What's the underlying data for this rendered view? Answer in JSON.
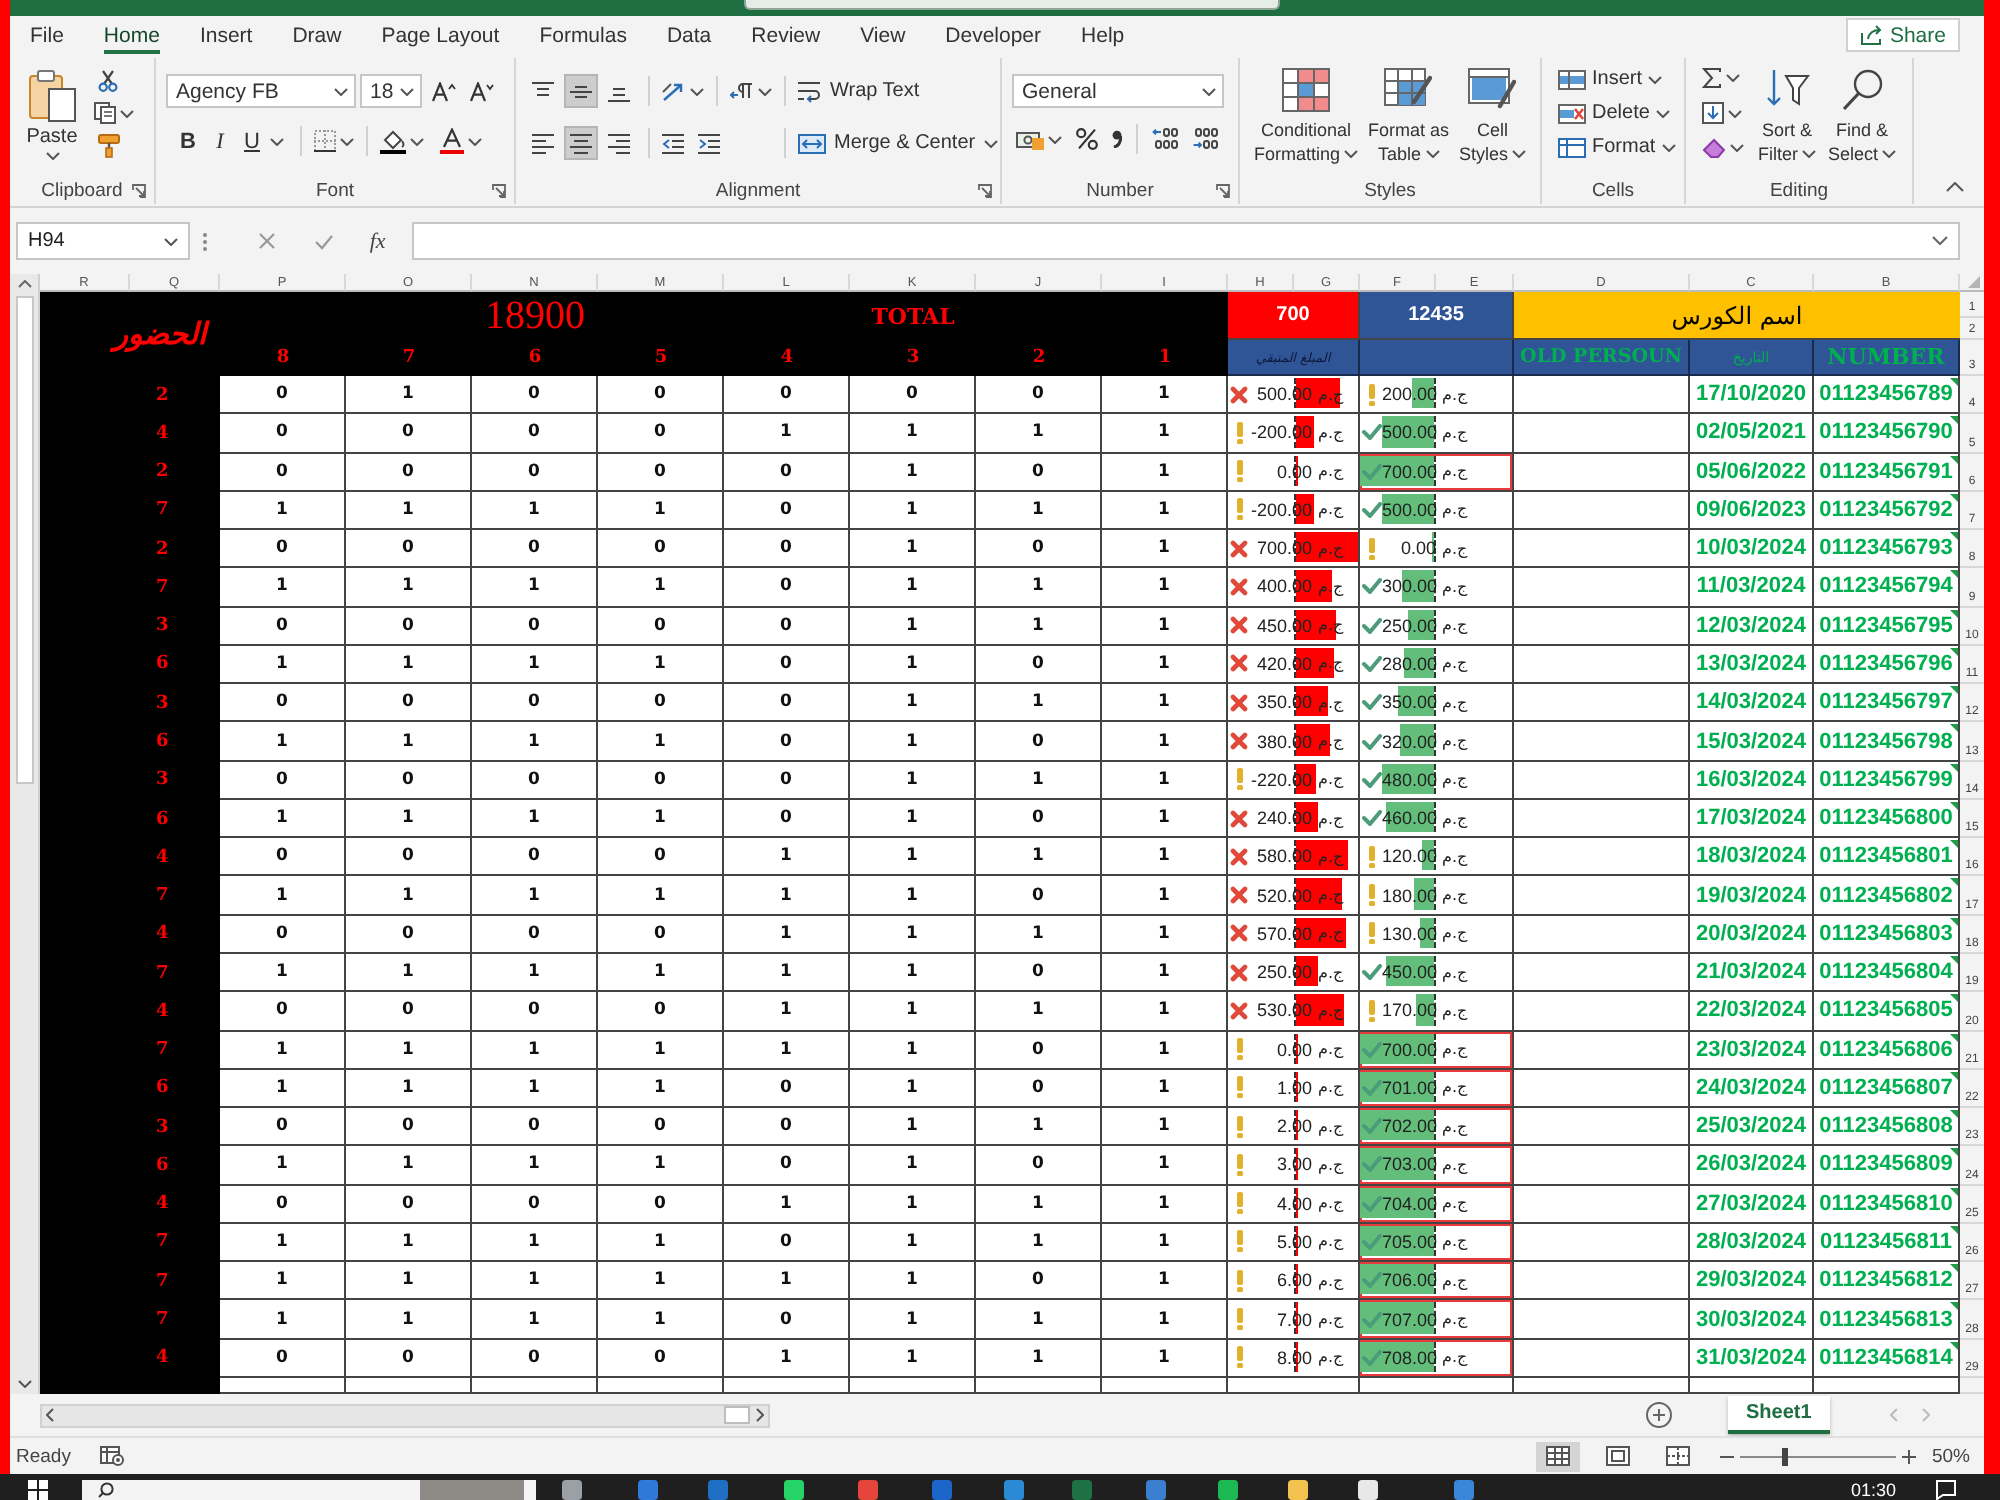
{
  "menu_tabs": [
    {
      "label": "File",
      "selected": false
    },
    {
      "label": "Home",
      "selected": true
    },
    {
      "label": "Insert",
      "selected": false
    },
    {
      "label": "Draw",
      "selected": false
    },
    {
      "label": "Page Layout",
      "selected": false
    },
    {
      "label": "Formulas",
      "selected": false
    },
    {
      "label": "Data",
      "selected": false
    },
    {
      "label": "Review",
      "selected": false
    },
    {
      "label": "View",
      "selected": false
    },
    {
      "label": "Developer",
      "selected": false
    },
    {
      "label": "Help",
      "selected": false
    }
  ],
  "share_button": "Share",
  "ribbon": {
    "clipboard": {
      "paste": "Paste",
      "label": "Clipboard"
    },
    "font": {
      "font_name": "Agency FB",
      "font_size": "18",
      "style_buttons": [
        "B",
        "I",
        "U"
      ],
      "label": "Font"
    },
    "alignment": {
      "vertical": [
        {
          "kind": "top",
          "selected": false
        },
        {
          "kind": "middle",
          "selected": true
        },
        {
          "kind": "bottom",
          "selected": false
        }
      ],
      "horizontal": [
        {
          "kind": "left",
          "selected": false
        },
        {
          "kind": "center",
          "selected": true
        },
        {
          "kind": "right",
          "selected": false
        }
      ],
      "wrap_text": "Wrap Text",
      "merge_center": "Merge & Center",
      "label": "Alignment"
    },
    "number": {
      "format": "General",
      "label": "Number"
    },
    "styles": {
      "buttons": [
        [
          "Conditional",
          "Formatting"
        ],
        [
          "Format as",
          "Table"
        ],
        [
          "Cell",
          "Styles"
        ]
      ],
      "label": "Styles"
    },
    "cells": {
      "buttons": [
        "Insert",
        "Delete",
        "Format"
      ],
      "label": "Cells"
    },
    "editing": {
      "buttons": [
        [
          "Sort &",
          "Filter"
        ],
        [
          "Find &",
          "Select"
        ]
      ],
      "label": "Editing"
    }
  },
  "formula_bar": {
    "name_box": "H94",
    "function_button": "fx"
  },
  "sheet": {
    "column_headers": [
      "R",
      "Q",
      "P",
      "O",
      "N",
      "M",
      "L",
      "K",
      "J",
      "I",
      "H",
      "G",
      "F",
      "E",
      "D",
      "C",
      "B"
    ],
    "row_headers": [
      "1",
      "2",
      "3",
      "4",
      "5",
      "6",
      "7",
      "8",
      "9",
      "10",
      "11",
      "12",
      "13",
      "14",
      "15",
      "16",
      "17",
      "18",
      "19",
      "20",
      "21",
      "22",
      "23",
      "24",
      "25",
      "26",
      "27",
      "28",
      "29"
    ],
    "attendance_title": "الحضور",
    "grand_total": "18900",
    "total_label": "TOTAL",
    "session_numbers": [
      "8",
      "7",
      "6",
      "5",
      "4",
      "3",
      "2",
      "1"
    ],
    "remaining_total": "700",
    "paid_total": "12435",
    "course_name": "اسم الكورس",
    "remaining_header": "المبلغ المتبقي",
    "old_person_header": "OLD PERSOUN",
    "date_header": "التاريخ",
    "number_header": "NUMBER",
    "rows": [
      {
        "attendance": "2",
        "sessions": [
          "0",
          "1",
          "0",
          "0",
          "0",
          "0",
          "0",
          "1"
        ],
        "remaining": {
          "kind": "cross",
          "amount": "500.00",
          "currency": "ج.م",
          "level": 0.71
        },
        "paid": {
          "kind": "warning",
          "amount": "200.00",
          "currency": "ج.م",
          "level": 0.29,
          "flagged": false
        },
        "date": "17/10/2020",
        "number": "01123456789"
      },
      {
        "attendance": "4",
        "sessions": [
          "0",
          "0",
          "0",
          "0",
          "1",
          "1",
          "1",
          "1"
        ],
        "remaining": {
          "kind": "warning",
          "amount": "-200.00",
          "currency": "ج.م",
          "level": 0.29
        },
        "paid": {
          "kind": "check",
          "amount": "500.00",
          "currency": "ج.م",
          "level": 0.71,
          "flagged": false
        },
        "date": "02/05/2021",
        "number": "01123456790"
      },
      {
        "attendance": "2",
        "sessions": [
          "0",
          "0",
          "0",
          "0",
          "0",
          "1",
          "0",
          "1"
        ],
        "remaining": {
          "kind": "warning",
          "amount": "0.00",
          "currency": "ج.م",
          "level": 0
        },
        "paid": {
          "kind": "check",
          "amount": "700.00",
          "currency": "ج.م",
          "level": 1,
          "flagged": true
        },
        "date": "05/06/2022",
        "number": "01123456791"
      },
      {
        "attendance": "7",
        "sessions": [
          "1",
          "1",
          "1",
          "1",
          "0",
          "1",
          "1",
          "1"
        ],
        "remaining": {
          "kind": "warning",
          "amount": "-200.00",
          "currency": "ج.م",
          "level": 0.29
        },
        "paid": {
          "kind": "check",
          "amount": "500.00",
          "currency": "ج.م",
          "level": 0.71,
          "flagged": false
        },
        "date": "09/06/2023",
        "number": "01123456792"
      },
      {
        "attendance": "2",
        "sessions": [
          "0",
          "0",
          "0",
          "0",
          "0",
          "1",
          "0",
          "1"
        ],
        "remaining": {
          "kind": "cross",
          "amount": "700.00",
          "currency": "ج.م",
          "level": 1
        },
        "paid": {
          "kind": "warning",
          "amount": "0.00",
          "currency": "ج.م",
          "level": 0,
          "flagged": false
        },
        "date": "10/03/2024",
        "number": "01123456793"
      },
      {
        "attendance": "7",
        "sessions": [
          "1",
          "1",
          "1",
          "1",
          "0",
          "1",
          "1",
          "1"
        ],
        "remaining": {
          "kind": "cross",
          "amount": "400.00",
          "currency": "ج.م",
          "level": 0.57
        },
        "paid": {
          "kind": "check",
          "amount": "300.00",
          "currency": "ج.م",
          "level": 0.43,
          "flagged": false
        },
        "date": "11/03/2024",
        "number": "01123456794"
      },
      {
        "attendance": "3",
        "sessions": [
          "0",
          "0",
          "0",
          "0",
          "0",
          "1",
          "1",
          "1"
        ],
        "remaining": {
          "kind": "cross",
          "amount": "450.00",
          "currency": "ج.م",
          "level": 0.64
        },
        "paid": {
          "kind": "check",
          "amount": "250.00",
          "currency": "ج.م",
          "level": 0.36,
          "flagged": false
        },
        "date": "12/03/2024",
        "number": "01123456795"
      },
      {
        "attendance": "6",
        "sessions": [
          "1",
          "1",
          "1",
          "1",
          "0",
          "1",
          "0",
          "1"
        ],
        "remaining": {
          "kind": "cross",
          "amount": "420.00",
          "currency": "ج.م",
          "level": 0.6
        },
        "paid": {
          "kind": "check",
          "amount": "280.00",
          "currency": "ج.م",
          "level": 0.4,
          "flagged": false
        },
        "date": "13/03/2024",
        "number": "01123456796"
      },
      {
        "attendance": "3",
        "sessions": [
          "0",
          "0",
          "0",
          "0",
          "0",
          "1",
          "1",
          "1"
        ],
        "remaining": {
          "kind": "cross",
          "amount": "350.00",
          "currency": "ج.م",
          "level": 0.5
        },
        "paid": {
          "kind": "check",
          "amount": "350.00",
          "currency": "ج.م",
          "level": 0.5,
          "flagged": false
        },
        "date": "14/03/2024",
        "number": "01123456797"
      },
      {
        "attendance": "6",
        "sessions": [
          "1",
          "1",
          "1",
          "1",
          "0",
          "1",
          "0",
          "1"
        ],
        "remaining": {
          "kind": "cross",
          "amount": "380.00",
          "currency": "ج.م",
          "level": 0.54
        },
        "paid": {
          "kind": "check",
          "amount": "320.00",
          "currency": "ج.م",
          "level": 0.46,
          "flagged": false
        },
        "date": "15/03/2024",
        "number": "01123456798"
      },
      {
        "attendance": "3",
        "sessions": [
          "0",
          "0",
          "0",
          "0",
          "0",
          "1",
          "1",
          "1"
        ],
        "remaining": {
          "kind": "warning",
          "amount": "-220.00",
          "currency": "ج.م",
          "level": 0.31
        },
        "paid": {
          "kind": "check",
          "amount": "480.00",
          "currency": "ج.م",
          "level": 0.69,
          "flagged": false
        },
        "date": "16/03/2024",
        "number": "01123456799"
      },
      {
        "attendance": "6",
        "sessions": [
          "1",
          "1",
          "1",
          "1",
          "0",
          "1",
          "0",
          "1"
        ],
        "remaining": {
          "kind": "cross",
          "amount": "240.00",
          "currency": "ج.م",
          "level": 0.34
        },
        "paid": {
          "kind": "check",
          "amount": "460.00",
          "currency": "ج.م",
          "level": 0.66,
          "flagged": false
        },
        "date": "17/03/2024",
        "number": "01123456800"
      },
      {
        "attendance": "4",
        "sessions": [
          "0",
          "0",
          "0",
          "0",
          "1",
          "1",
          "1",
          "1"
        ],
        "remaining": {
          "kind": "cross",
          "amount": "580.00",
          "currency": "ج.م",
          "level": 0.83
        },
        "paid": {
          "kind": "warning",
          "amount": "120.00",
          "currency": "ج.م",
          "level": 0.17,
          "flagged": false
        },
        "date": "18/03/2024",
        "number": "01123456801"
      },
      {
        "attendance": "7",
        "sessions": [
          "1",
          "1",
          "1",
          "1",
          "1",
          "1",
          "0",
          "1"
        ],
        "remaining": {
          "kind": "cross",
          "amount": "520.00",
          "currency": "ج.م",
          "level": 0.74
        },
        "paid": {
          "kind": "warning",
          "amount": "180.00",
          "currency": "ج.م",
          "level": 0.26,
          "flagged": false
        },
        "date": "19/03/2024",
        "number": "01123456802"
      },
      {
        "attendance": "4",
        "sessions": [
          "0",
          "0",
          "0",
          "0",
          "1",
          "1",
          "1",
          "1"
        ],
        "remaining": {
          "kind": "cross",
          "amount": "570.00",
          "currency": "ج.م",
          "level": 0.81
        },
        "paid": {
          "kind": "warning",
          "amount": "130.00",
          "currency": "ج.م",
          "level": 0.19,
          "flagged": false
        },
        "date": "20/03/2024",
        "number": "01123456803"
      },
      {
        "attendance": "7",
        "sessions": [
          "1",
          "1",
          "1",
          "1",
          "1",
          "1",
          "0",
          "1"
        ],
        "remaining": {
          "kind": "cross",
          "amount": "250.00",
          "currency": "ج.م",
          "level": 0.36
        },
        "paid": {
          "kind": "check",
          "amount": "450.00",
          "currency": "ج.م",
          "level": 0.64,
          "flagged": false
        },
        "date": "21/03/2024",
        "number": "01123456804"
      },
      {
        "attendance": "4",
        "sessions": [
          "0",
          "0",
          "0",
          "0",
          "1",
          "1",
          "1",
          "1"
        ],
        "remaining": {
          "kind": "cross",
          "amount": "530.00",
          "currency": "ج.م",
          "level": 0.76
        },
        "paid": {
          "kind": "warning",
          "amount": "170.00",
          "currency": "ج.م",
          "level": 0.24,
          "flagged": false
        },
        "date": "22/03/2024",
        "number": "01123456805"
      },
      {
        "attendance": "7",
        "sessions": [
          "1",
          "1",
          "1",
          "1",
          "1",
          "1",
          "0",
          "1"
        ],
        "remaining": {
          "kind": "warning",
          "amount": "0.00",
          "currency": "ج.م",
          "level": 0
        },
        "paid": {
          "kind": "check",
          "amount": "700.00",
          "currency": "ج.م",
          "level": 1,
          "flagged": true
        },
        "date": "23/03/2024",
        "number": "01123456806"
      },
      {
        "attendance": "6",
        "sessions": [
          "1",
          "1",
          "1",
          "1",
          "0",
          "1",
          "0",
          "1"
        ],
        "remaining": {
          "kind": "warning",
          "amount": "1.00",
          "currency": "ج.م",
          "level": 0
        },
        "paid": {
          "kind": "check",
          "amount": "701.00",
          "currency": "ج.م",
          "level": 1,
          "flagged": true
        },
        "date": "24/03/2024",
        "number": "01123456807"
      },
      {
        "attendance": "3",
        "sessions": [
          "0",
          "0",
          "0",
          "0",
          "0",
          "1",
          "1",
          "1"
        ],
        "remaining": {
          "kind": "warning",
          "amount": "2.00",
          "currency": "ج.م",
          "level": 0
        },
        "paid": {
          "kind": "check",
          "amount": "702.00",
          "currency": "ج.م",
          "level": 1,
          "flagged": true
        },
        "date": "25/03/2024",
        "number": "01123456808"
      },
      {
        "attendance": "6",
        "sessions": [
          "1",
          "1",
          "1",
          "1",
          "0",
          "1",
          "0",
          "1"
        ],
        "remaining": {
          "kind": "warning",
          "amount": "3.00",
          "currency": "ج.م",
          "level": 0
        },
        "paid": {
          "kind": "check",
          "amount": "703.00",
          "currency": "ج.م",
          "level": 1,
          "flagged": true
        },
        "date": "26/03/2024",
        "number": "01123456809"
      },
      {
        "attendance": "4",
        "sessions": [
          "0",
          "0",
          "0",
          "0",
          "1",
          "1",
          "1",
          "1"
        ],
        "remaining": {
          "kind": "warning",
          "amount": "4.00",
          "currency": "ج.م",
          "level": 0
        },
        "paid": {
          "kind": "check",
          "amount": "704.00",
          "currency": "ج.م",
          "level": 1,
          "flagged": true
        },
        "date": "27/03/2024",
        "number": "01123456810"
      },
      {
        "attendance": "7",
        "sessions": [
          "1",
          "1",
          "1",
          "1",
          "0",
          "1",
          "1",
          "1"
        ],
        "remaining": {
          "kind": "warning",
          "amount": "5.00",
          "currency": "ج.م",
          "level": 0
        },
        "paid": {
          "kind": "check",
          "amount": "705.00",
          "currency": "ج.م",
          "level": 1,
          "flagged": true
        },
        "date": "28/03/2024",
        "number": "01123456811"
      },
      {
        "attendance": "7",
        "sessions": [
          "1",
          "1",
          "1",
          "1",
          "1",
          "1",
          "0",
          "1"
        ],
        "remaining": {
          "kind": "warning",
          "amount": "6.00",
          "currency": "ج.م",
          "level": 0
        },
        "paid": {
          "kind": "check",
          "amount": "706.00",
          "currency": "ج.م",
          "level": 1,
          "flagged": true
        },
        "date": "29/03/2024",
        "number": "01123456812"
      },
      {
        "attendance": "7",
        "sessions": [
          "1",
          "1",
          "1",
          "1",
          "0",
          "1",
          "1",
          "1"
        ],
        "remaining": {
          "kind": "warning",
          "amount": "7.00",
          "currency": "ج.م",
          "level": 0
        },
        "paid": {
          "kind": "check",
          "amount": "707.00",
          "currency": "ج.م",
          "level": 1,
          "flagged": true
        },
        "date": "30/03/2024",
        "number": "01123456813"
      },
      {
        "attendance": "4",
        "sessions": [
          "0",
          "0",
          "0",
          "0",
          "1",
          "1",
          "1",
          "1"
        ],
        "remaining": {
          "kind": "warning",
          "amount": "8.00",
          "currency": "ج.م",
          "level": 0
        },
        "paid": {
          "kind": "check",
          "amount": "708.00",
          "currency": "ج.م",
          "level": 1,
          "flagged": true
        },
        "date": "31/03/2024",
        "number": "01123456814"
      }
    ]
  },
  "sheet_tabs": [
    {
      "label": "Sheet1",
      "selected": true
    }
  ],
  "status_bar": {
    "status": "Ready",
    "views": [
      {
        "kind": "normal",
        "selected": true
      },
      {
        "kind": "page_layout",
        "selected": false
      },
      {
        "kind": "page_break",
        "selected": false
      }
    ],
    "zoom_slider": {
      "level": 0.28
    },
    "zoom": "50%"
  },
  "taskbar": {
    "time": "01:30"
  }
}
